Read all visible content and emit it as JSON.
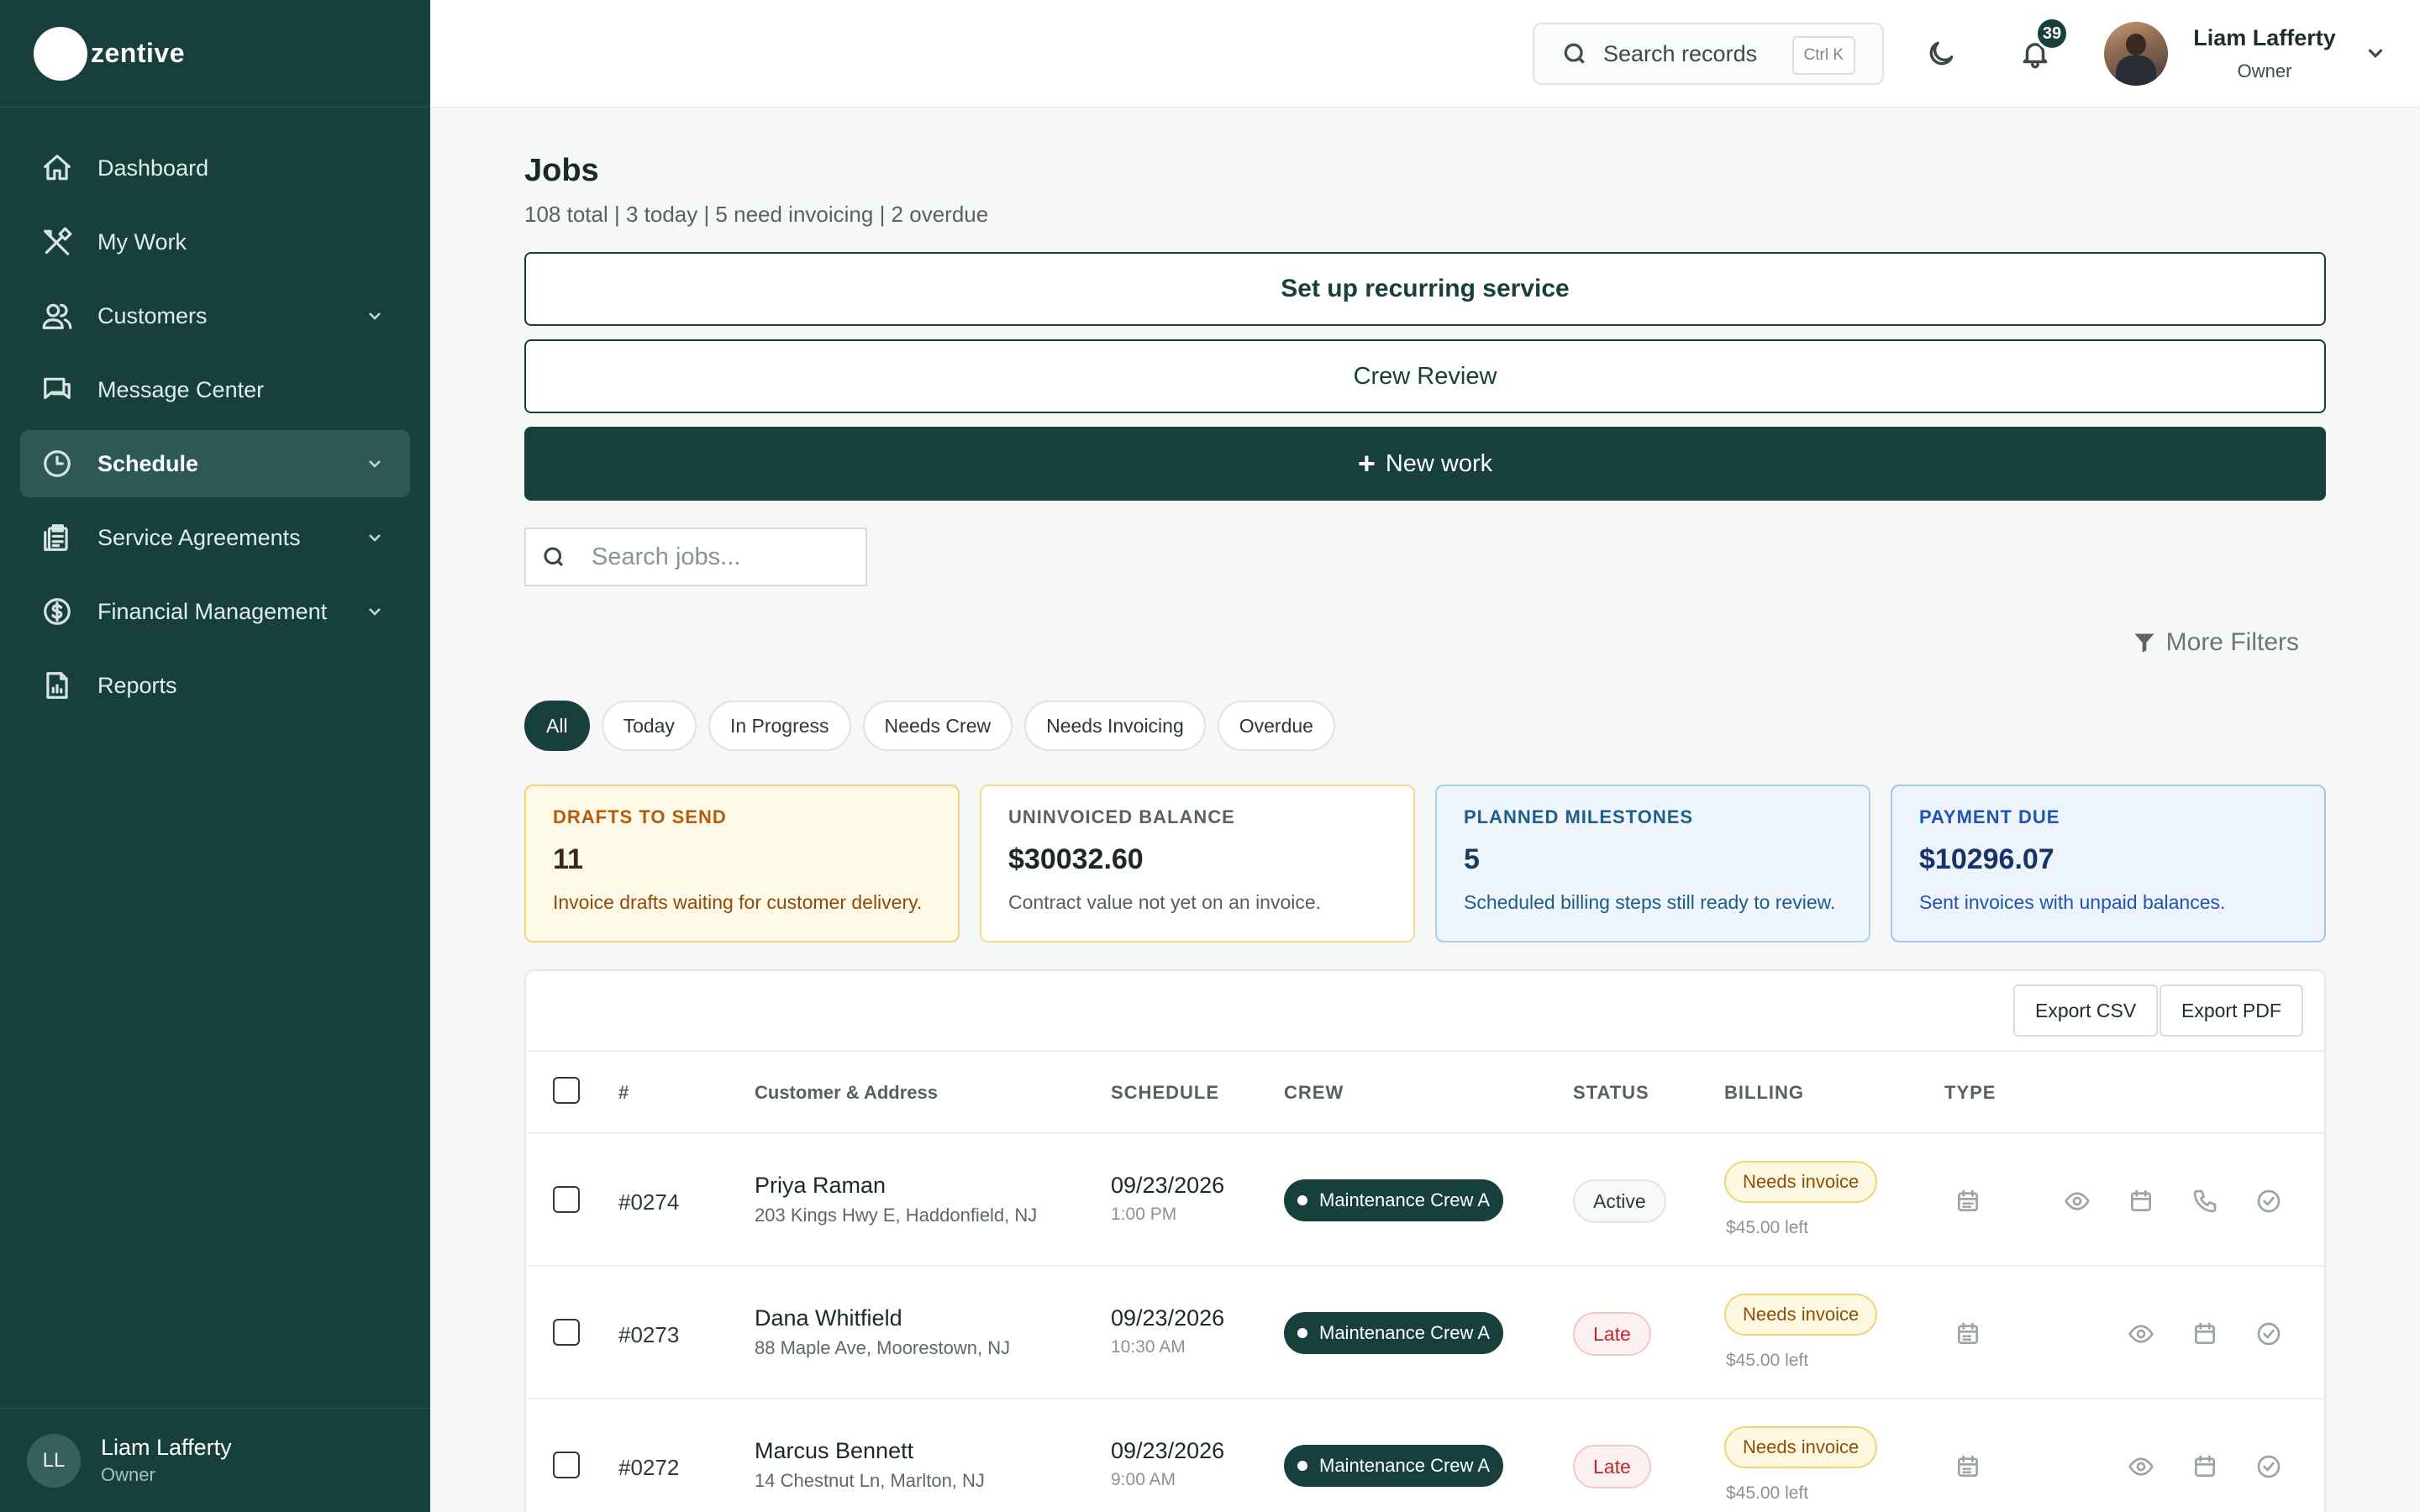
{
  "brand": {
    "name": "zentive"
  },
  "sidebar": {
    "items": [
      {
        "label": "Dashboard"
      },
      {
        "label": "My Work"
      },
      {
        "label": "Customers"
      },
      {
        "label": "Message Center"
      },
      {
        "label": "Schedule"
      },
      {
        "label": "Service Agreements"
      },
      {
        "label": "Financial Management"
      },
      {
        "label": "Reports"
      }
    ],
    "user": {
      "initials": "LL",
      "name": "Liam Lafferty",
      "role": "Owner"
    }
  },
  "topbar": {
    "search_label": "Search records",
    "search_shortcut": "Ctrl K",
    "notification_count": "39",
    "user_name": "Liam Lafferty",
    "user_role": "Owner"
  },
  "page": {
    "title": "Jobs",
    "subtitle": "108 total | 3 today | 5 need invoicing | 2 overdue",
    "btn_recurring": "Set up recurring service",
    "btn_crew_review": "Crew Review",
    "btn_new_work": "New work",
    "search_placeholder": "Search jobs...",
    "more_filters": "More Filters",
    "filters": [
      "All",
      "Today",
      "In Progress",
      "Needs Crew",
      "Needs Invoicing",
      "Overdue"
    ]
  },
  "cards": [
    {
      "title": "DRAFTS TO SEND",
      "value": "11",
      "desc": "Invoice drafts waiting for customer delivery."
    },
    {
      "title": "UNINVOICED BALANCE",
      "value": "$30032.60",
      "desc": "Contract value not yet on an invoice."
    },
    {
      "title": "PLANNED MILESTONES",
      "value": "5",
      "desc": "Scheduled billing steps still ready to review."
    },
    {
      "title": "PAYMENT DUE",
      "value": "$10296.07",
      "desc": "Sent invoices with unpaid balances."
    }
  ],
  "table": {
    "export_csv": "Export CSV",
    "export_pdf": "Export PDF",
    "headers": {
      "num": "#",
      "customer": "Customer & Address",
      "schedule": "SCHEDULE",
      "crew": "CREW",
      "status": "STATUS",
      "billing": "BILLING",
      "type": "TYPE"
    },
    "rows": [
      {
        "num": "#0274",
        "name": "Priya Raman",
        "address": "203 Kings Hwy E, Haddonfield, NJ",
        "date": "09/23/2026",
        "time": "1:00 PM",
        "crew": "Maintenance Crew A",
        "status": "Active",
        "billing": "Needs invoice",
        "billing_left": "$45.00 left"
      },
      {
        "num": "#0273",
        "name": "Dana Whitfield",
        "address": "88 Maple Ave, Moorestown, NJ",
        "date": "09/23/2026",
        "time": "10:30 AM",
        "crew": "Maintenance Crew A",
        "status": "Late",
        "billing": "Needs invoice",
        "billing_left": "$45.00 left"
      },
      {
        "num": "#0272",
        "name": "Marcus Bennett",
        "address": "14 Chestnut Ln, Marlton, NJ",
        "date": "09/23/2026",
        "time": "9:00 AM",
        "crew": "Maintenance Crew A",
        "status": "Late",
        "billing": "Needs invoice",
        "billing_left": "$45.00 left"
      }
    ]
  }
}
